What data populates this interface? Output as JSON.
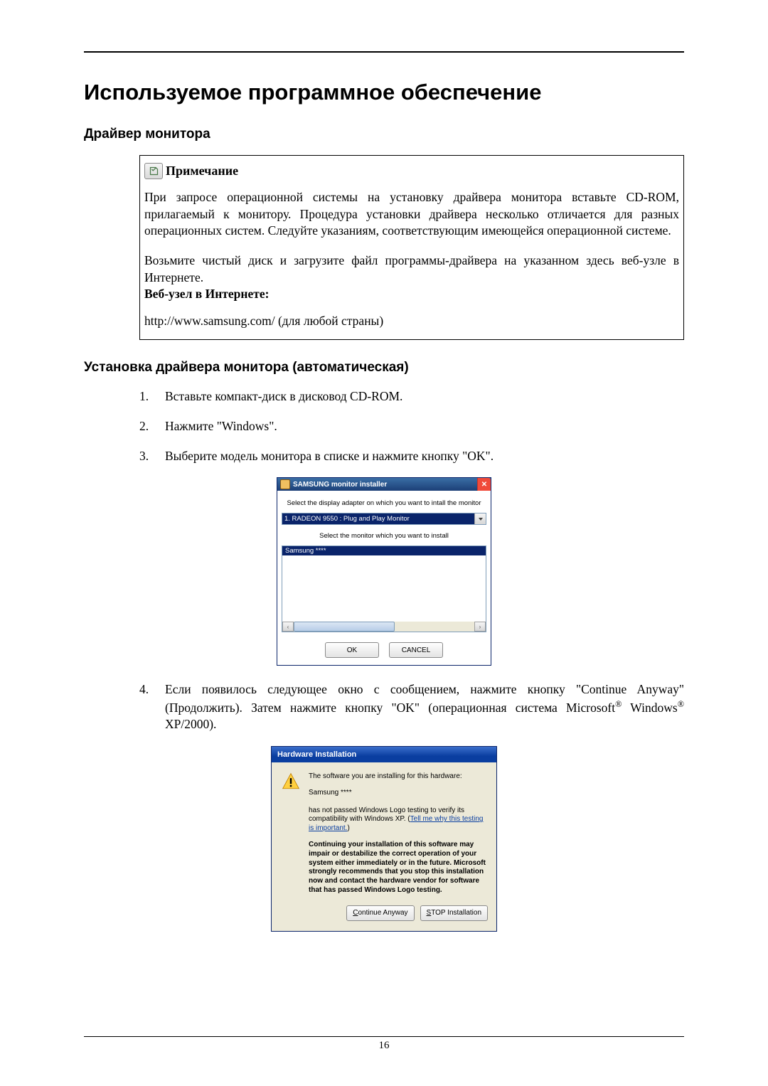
{
  "page": {
    "title": "Используемое программное обеспечение",
    "section1": "Драйвер монитора",
    "note_label": "Примечание",
    "note_p1": "При запросе операционной системы на установку драйвера монитора вставьте CD-ROM, прилагаемый к монитору. Процедура установки драйвера несколько отличается для разных операционных систем. Следуйте указаниям, соответствующим имеющейся операционной системе.",
    "note_p2": "Возьмите чистый диск и загрузите файл программы-драйвера на указанном здесь веб-узле в Интернете.",
    "note_bold": "Веб-узел в Интернете:",
    "note_url": "http://www.samsung.com/ (для любой страны)",
    "section2": "Установка драйвера монитора (автоматическая)",
    "step1": "Вставьте компакт-диск в дисковод CD-ROM.",
    "step2": "Нажмите \"Windows\".",
    "step3": "Выберите модель монитора в списке и нажмите кнопку \"OK\".",
    "step4_a": "Если появилось следующее окно с сообщением, нажмите кнопку \"Continue Anyway\" (Продолжить). Затем нажмите кнопку \"OK\" (операционная система Microsoft",
    "step4_b": " Windows",
    "step4_c": " XP/2000).",
    "footer": "16"
  },
  "dlg1": {
    "title": "SAMSUNG monitor installer",
    "label1": "Select the display adapter on which you want to intall the monitor",
    "combo": "1. RADEON 9550 : Plug and Play Monitor",
    "label2": "Select the monitor which you want to install",
    "list_item": "Samsung ****",
    "ok": "OK",
    "cancel": "CANCEL"
  },
  "dlg2": {
    "title": "Hardware Installation",
    "p1": "The software you are installing for this hardware:",
    "name": "Samsung ****",
    "p2a": "has not passed Windows Logo testing to verify its compatibility with Windows XP. (",
    "link": "Tell me why this testing is important.",
    "p2b": ")",
    "bold": "Continuing your installation of this software may impair or destabilize the correct operation of your system either immediately or in the future. Microsoft strongly recommends that you stop this installation now and contact the hardware vendor for software that has passed Windows Logo testing.",
    "btn_continue_u": "C",
    "btn_continue_rest": "ontinue Anyway",
    "btn_stop_u": "S",
    "btn_stop_rest": "TOP Installation"
  }
}
